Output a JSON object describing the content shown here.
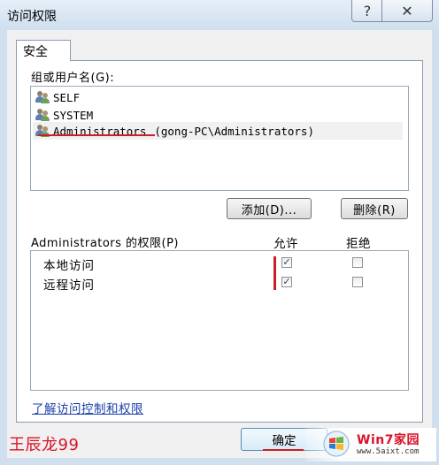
{
  "window": {
    "title": "访问权限",
    "help_label": "?",
    "close_label": "✕"
  },
  "tabs": [
    {
      "label": "安全"
    }
  ],
  "group_section": {
    "label": "组或用户名(G):",
    "users": [
      {
        "name": "SELF",
        "detail": ""
      },
      {
        "name": "SYSTEM",
        "detail": ""
      },
      {
        "name": "Administrators",
        "detail": "(gong-PC\\Administrators)"
      }
    ],
    "selected_index": 2
  },
  "buttons": {
    "add_label": "添加(D)...",
    "remove_label": "删除(R)",
    "ok_label": "确定"
  },
  "permissions": {
    "label": "Administrators 的权限(P)",
    "allow_header": "允许",
    "deny_header": "拒绝",
    "rows": [
      {
        "name": "本地访问",
        "allow": true,
        "deny": false
      },
      {
        "name": "远程访问",
        "allow": true,
        "deny": false
      }
    ]
  },
  "link_text": "了解访问控制和权限",
  "watermark": {
    "author": "王辰龙99",
    "brand": "Win7家园",
    "url": "www.5aixt.com"
  },
  "colors": {
    "frame": "#cfdfee",
    "panel": "#f0f0f0",
    "highlight_red": "#c81e28",
    "link": "#1a3fa8"
  }
}
